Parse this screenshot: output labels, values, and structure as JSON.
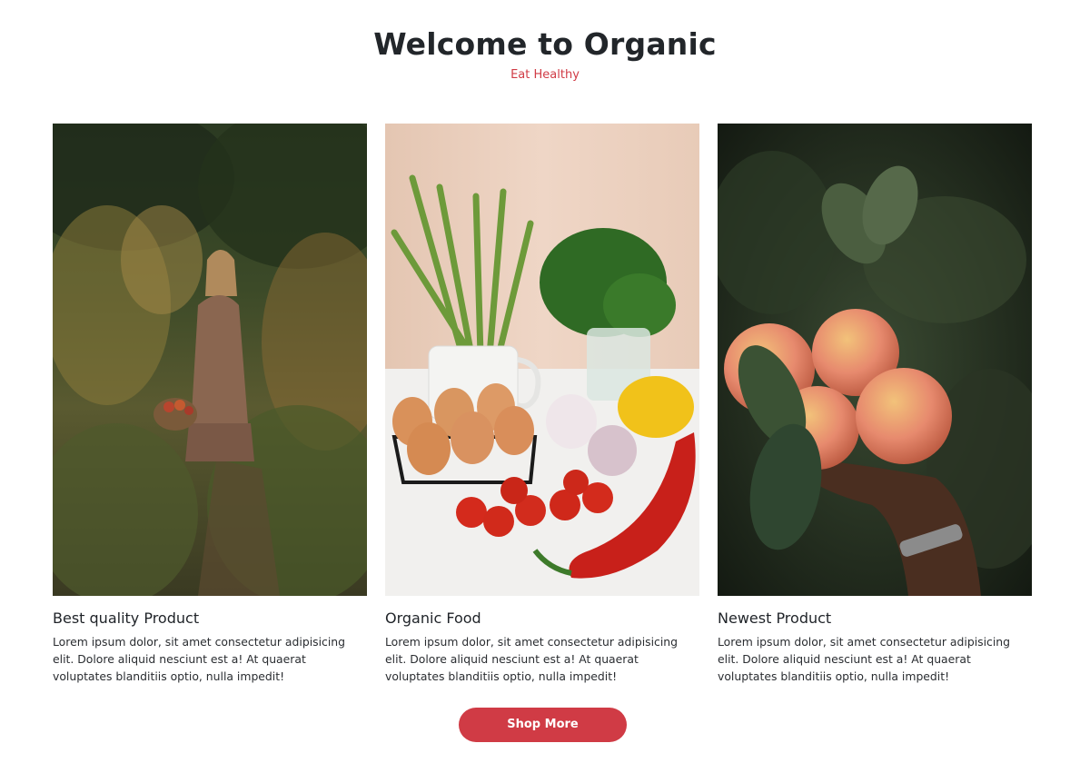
{
  "header": {
    "title": "Welcome to Organic",
    "subtitle": "Eat Healthy"
  },
  "cards": [
    {
      "image_subject": "woman-in-meadow-photo",
      "title": "Best quality Product",
      "text": "Lorem ipsum dolor, sit amet consectetur adipisicing elit. Dolore aliquid nesciunt est a! At quaerat voluptates blanditiis optio, nulla impedit!"
    },
    {
      "image_subject": "vegetables-and-eggs-photo",
      "title": "Organic Food",
      "text": "Lorem ipsum dolor, sit amet consectetur adipisicing elit. Dolore aliquid nesciunt est a! At quaerat voluptates blanditiis optio, nulla impedit!"
    },
    {
      "image_subject": "hand-holding-apples-photo",
      "title": "Newest Product",
      "text": "Lorem ipsum dolor, sit amet consectetur adipisicing elit. Dolore aliquid nesciunt est a! At quaerat voluptates blanditiis optio, nulla impedit!"
    }
  ],
  "cta": {
    "label": "Shop More"
  },
  "colors": {
    "accent": "#d03b45",
    "heading": "#22262a",
    "body_text": "#2a2d31",
    "background": "#ffffff"
  }
}
